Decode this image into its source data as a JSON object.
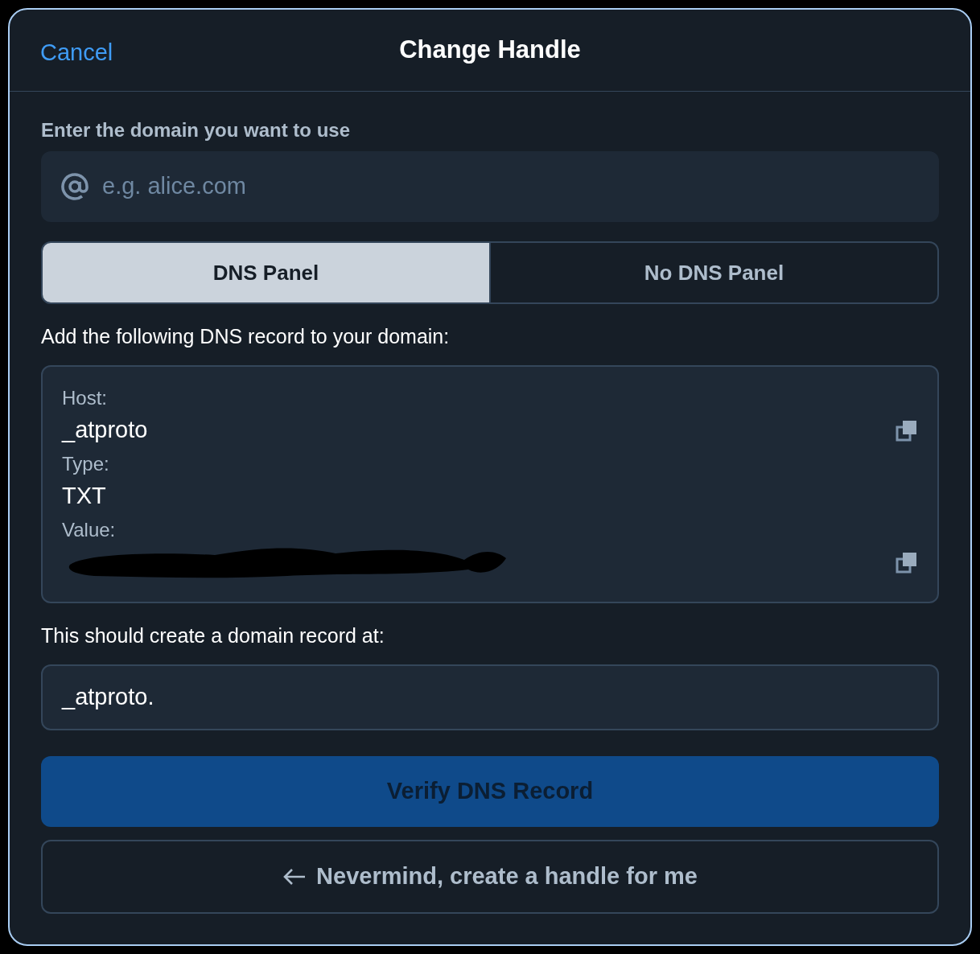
{
  "header": {
    "cancel": "Cancel",
    "title": "Change Handle"
  },
  "domain": {
    "label": "Enter the domain you want to use",
    "placeholder": "e.g. alice.com"
  },
  "tabs": [
    {
      "label": "DNS Panel",
      "selected": true
    },
    {
      "label": "No DNS Panel",
      "selected": false
    }
  ],
  "instructions": "Add the following DNS record to your domain:",
  "record": [
    {
      "label": "Host:",
      "value": "_atproto",
      "copyable": true,
      "redacted": false
    },
    {
      "label": "Type:",
      "value": "TXT",
      "copyable": false,
      "redacted": false
    },
    {
      "label": "Value:",
      "copyable": true,
      "redacted": true
    }
  ],
  "result": {
    "label": "This should create a domain record at:",
    "value": "_atproto."
  },
  "verify_button": {
    "label": "Verify DNS Record",
    "disabled": true
  },
  "back_button": {
    "label": "Nevermind, create a handle for me"
  }
}
